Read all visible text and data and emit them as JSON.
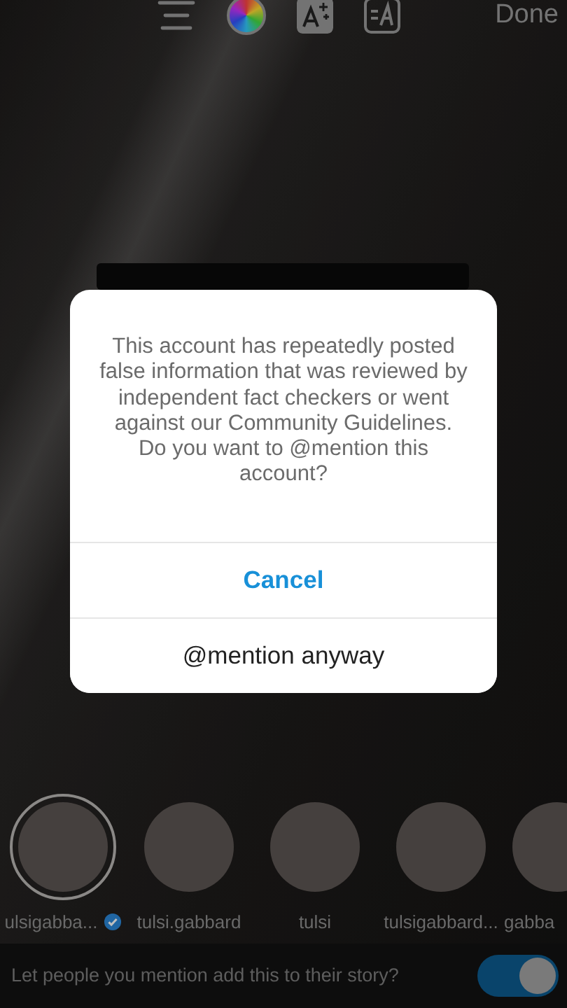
{
  "toolbar": {
    "done": "Done"
  },
  "dialog": {
    "message": "This account has repeatedly posted false information that was reviewed by independent fact checkers or went against our Community Guidelines.",
    "question": "Do you want to @mention this account?",
    "actions": [
      {
        "label": "Cancel",
        "kind": "primary"
      },
      {
        "label": "@mention anyway",
        "kind": "plain"
      }
    ]
  },
  "suggestions": [
    {
      "label": "ulsigabba...",
      "verified": true,
      "selected": true
    },
    {
      "label": "tulsi.gabbard",
      "verified": false,
      "selected": false
    },
    {
      "label": "tulsi",
      "verified": false,
      "selected": false
    },
    {
      "label": "tulsigabbard...",
      "verified": false,
      "selected": false
    },
    {
      "label": "gabba",
      "verified": false,
      "selected": false
    }
  ],
  "share_option": {
    "label": "Let people you mention add this to their story?",
    "on": true
  }
}
